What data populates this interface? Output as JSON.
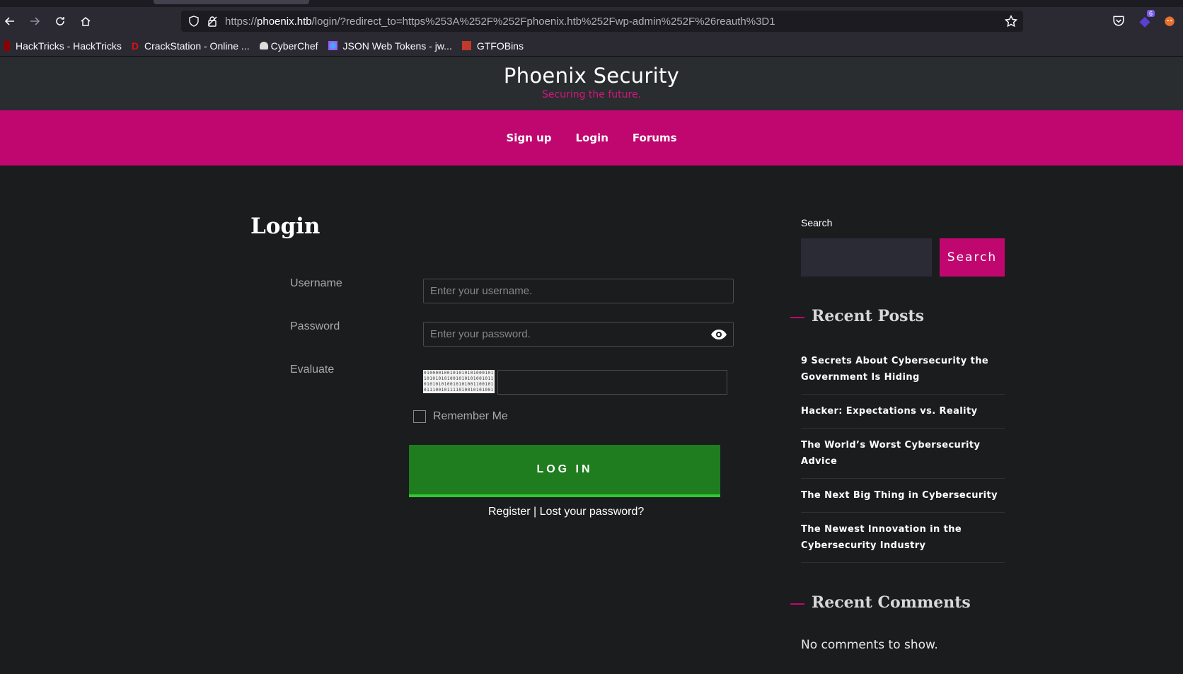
{
  "browser": {
    "url_prefix": "https://",
    "url_host": "phoenix.htb",
    "url_rest": "/login/?redirect_to=https%253A%252F%252Fphoenix.htb%252Fwp-admin%252F%26reauth%3D1",
    "extension_badge": "6",
    "bookmarks": [
      {
        "label": "HackTricks - HackTricks",
        "color": "#8b0000"
      },
      {
        "label": "CrackStation - Online ...",
        "color": "#e01010"
      },
      {
        "label": "CyberChef",
        "color": "#dddddd"
      },
      {
        "label": "JSON Web Tokens - jw...",
        "color": "#9b59f0"
      },
      {
        "label": "GTFOBins",
        "color": "#c0392b"
      }
    ]
  },
  "site": {
    "title": "Phoenix Security",
    "tagline": "Securing the future.",
    "nav": [
      "Sign up",
      "Login",
      "Forums"
    ]
  },
  "login": {
    "title": "Login",
    "username_label": "Username",
    "username_placeholder": "Enter your username.",
    "password_label": "Password",
    "password_placeholder": "Enter your password.",
    "captcha_label": "Evaluate",
    "captcha_text": "010000100101010101000101101010101001010101001011010101010010101001100101011100101111010010101001010101001010101001",
    "remember_label": "Remember Me",
    "submit_label": "LOG IN",
    "register_link": "Register",
    "separator": "|",
    "lost_password_link": "Lost your password?"
  },
  "sidebar": {
    "search_label": "Search",
    "search_button": "Search",
    "recent_posts_title": "Recent Posts",
    "recent_posts": [
      "9 Secrets About Cybersecurity the Government Is Hiding",
      "Hacker: Expectations vs. Reality",
      "The World’s Worst Cybersecurity Advice",
      "The Next Big Thing in Cybersecurity",
      "The Newest Innovation in the Cybersecurity Industry"
    ],
    "recent_comments_title": "Recent Comments",
    "no_comments": "No comments to show."
  },
  "colors": {
    "brand": "#c0076f",
    "login_button": "#1f7d1f",
    "background": "#1b1c1e"
  }
}
